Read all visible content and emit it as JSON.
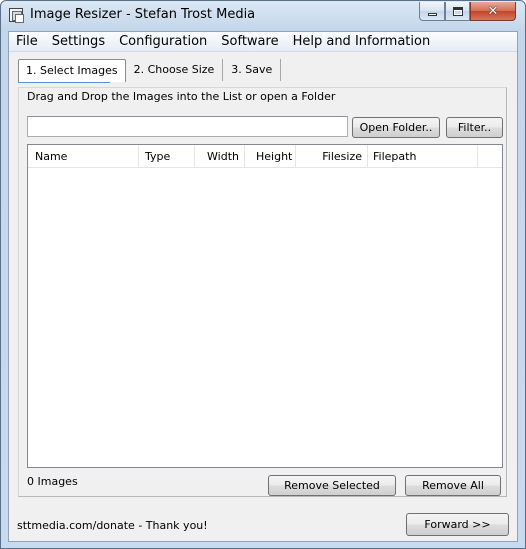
{
  "window": {
    "title": "Image Resizer - Stefan Trost Media"
  },
  "menu": {
    "items": [
      "File",
      "Settings",
      "Configuration",
      "Software",
      "Help and Information"
    ]
  },
  "tabs": [
    {
      "label": "1. Select Images",
      "active": true
    },
    {
      "label": "2. Choose Size",
      "active": false
    },
    {
      "label": "3. Save",
      "active": false
    }
  ],
  "select_page": {
    "hint": "Drag and Drop the Images into the List or open a Folder",
    "folder_value": "",
    "open_folder_label": "Open Folder..",
    "filter_label": "Filter..",
    "columns": [
      "Name",
      "Type",
      "Width",
      "Height",
      "Filesize",
      "Filepath"
    ],
    "count_text": "0 Images",
    "remove_selected_label": "Remove Selected",
    "remove_all_label": "Remove All"
  },
  "footer": {
    "donate_text": "sttmedia.com/donate - Thank you!",
    "forward_label": "Forward >>"
  },
  "icons": {
    "app": "app-window-icon",
    "minimize": "minimize-icon",
    "maximize": "maximize-icon",
    "close": "close-icon"
  },
  "colors": {
    "title_bar": "#c3d6ea",
    "close_button": "#c2452b",
    "active_tab_accent": "#5b8ee0"
  }
}
